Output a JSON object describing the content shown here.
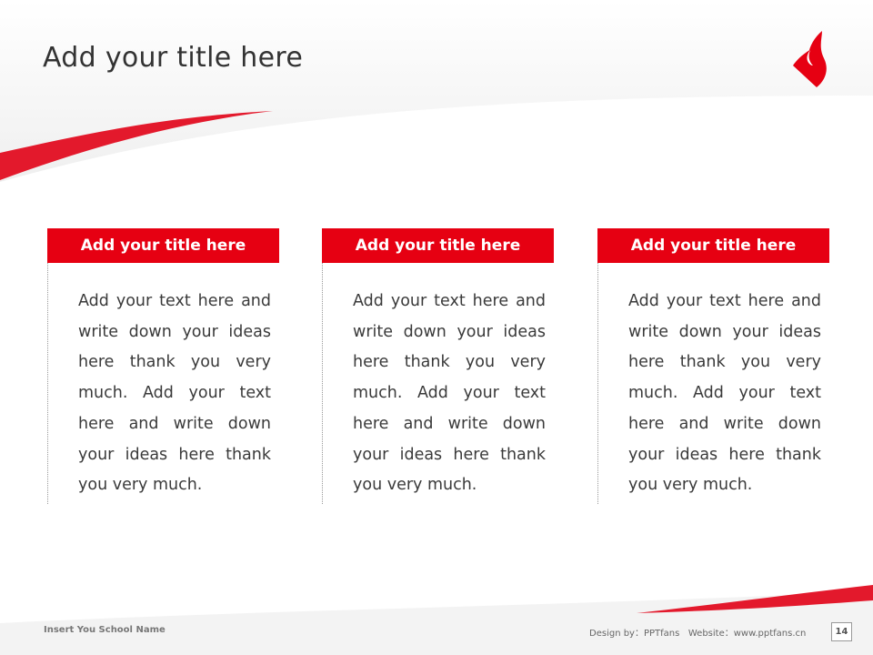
{
  "slide": {
    "title": "Add your title here",
    "accent_color": "#e60012",
    "logo_icon": "flame-logo-icon"
  },
  "cards": [
    {
      "title": "Add your title here",
      "text": "Add your text here and write down your ideas here thank you very much. Add your text here and write down your ideas here thank you very much."
    },
    {
      "title": "Add your title here",
      "text": "Add your text here and write down your ideas here thank you very much. Add your text here and write down your ideas here thank you very much."
    },
    {
      "title": "Add your title here",
      "text": "Add your text here and write down your ideas here thank you very much. Add your text here and write down your ideas here thank you very much."
    }
  ],
  "footer": {
    "school_name": "Insert You School Name",
    "design_credit": "Design by：PPTfans   Website：www.pptfans.cn",
    "page_number": "14"
  }
}
